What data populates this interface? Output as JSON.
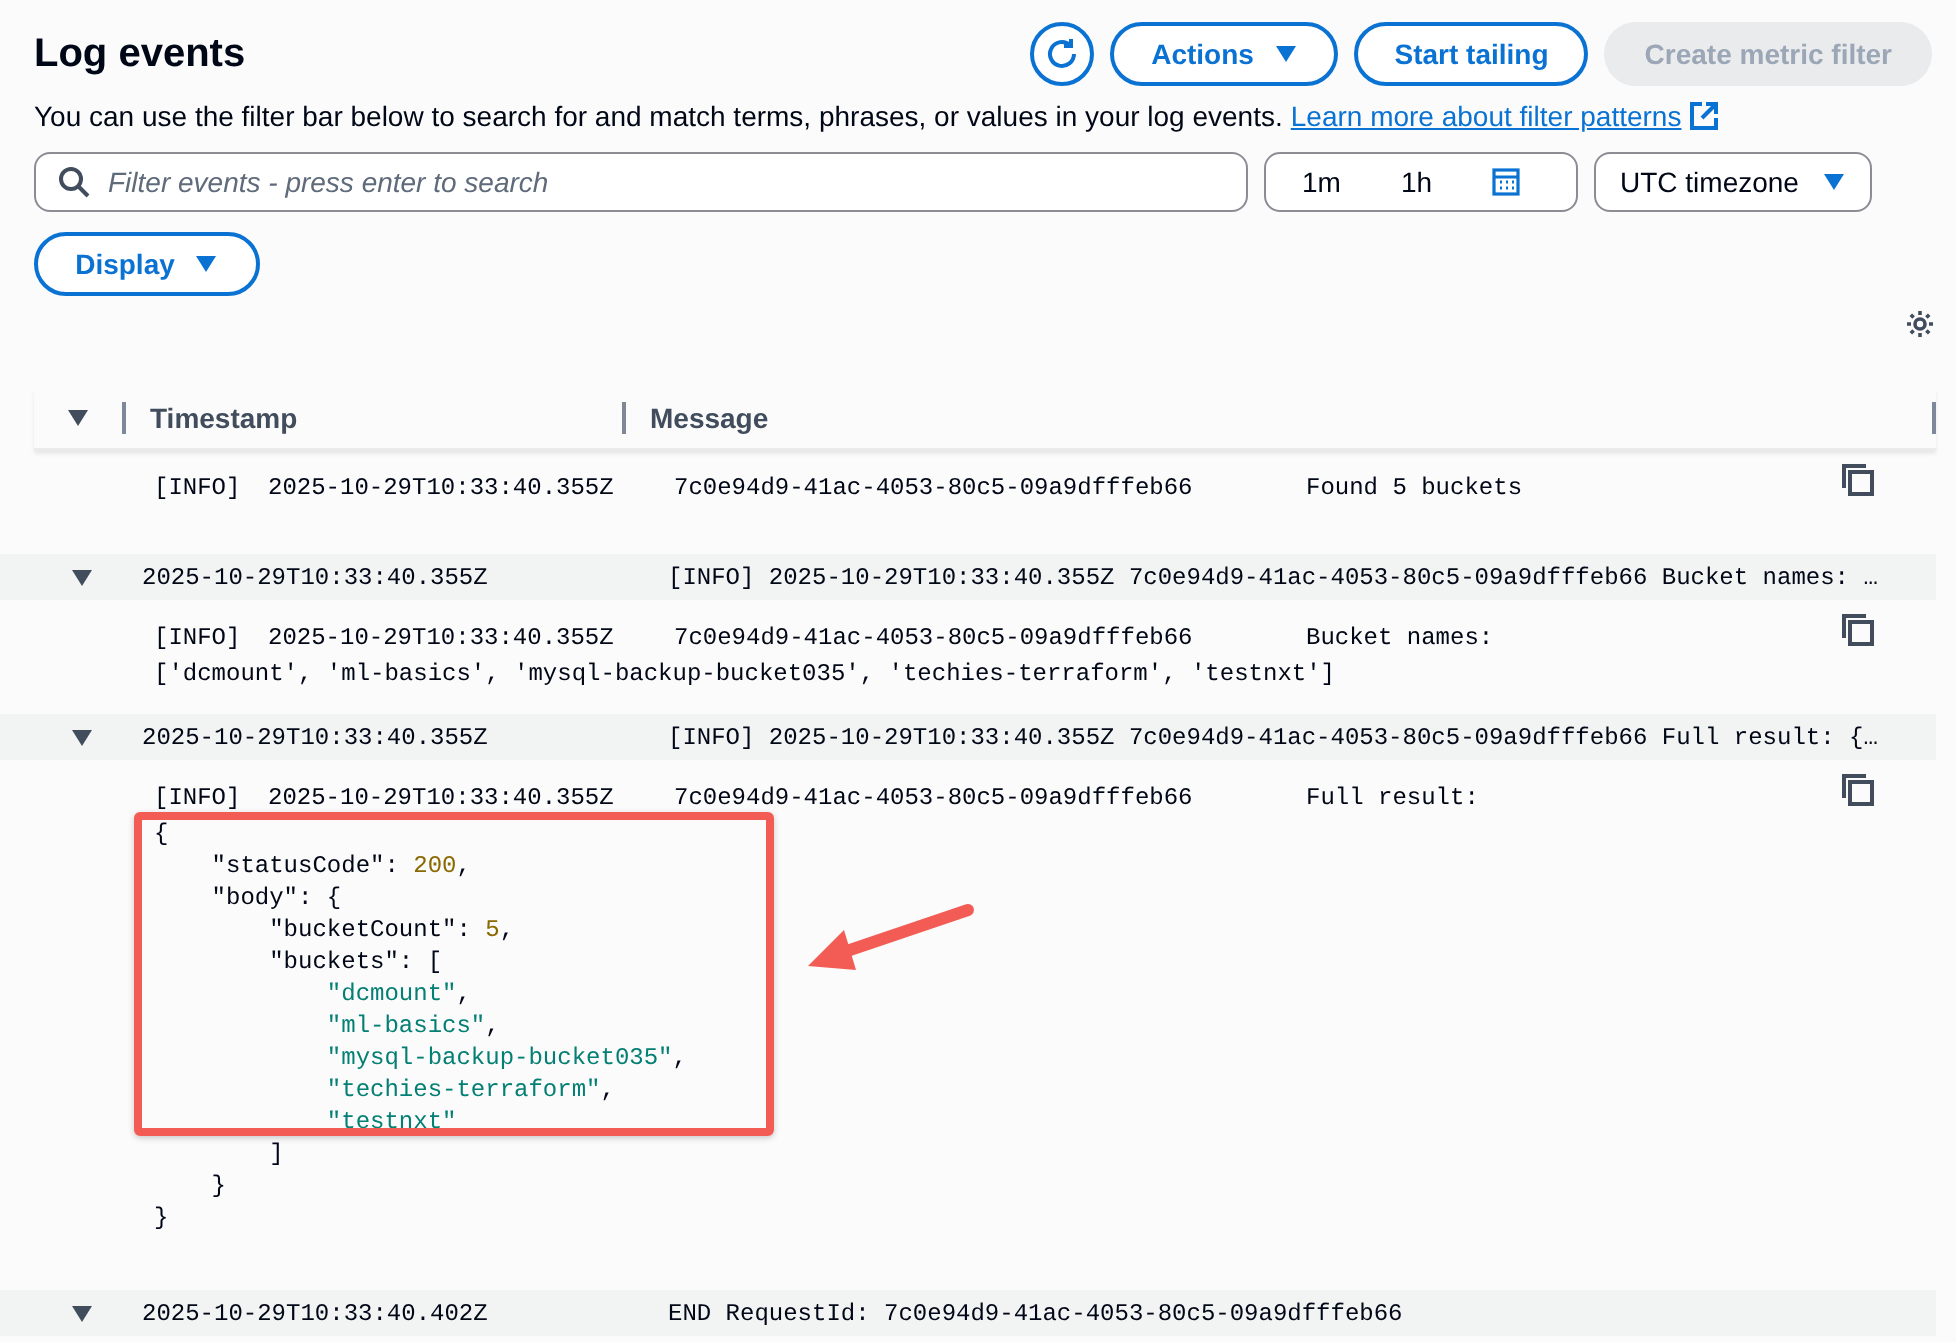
{
  "header": {
    "title": "Log events",
    "actions": "Actions",
    "start_tailing": "Start tailing",
    "create_metric_filter": "Create metric filter",
    "description": "You can use the filter bar below to search for and match terms, phrases, or values in your log events.",
    "learn_more": "Learn more about filter patterns"
  },
  "filter": {
    "placeholder": "Filter events - press enter to search",
    "ranges": [
      {
        "label": "1m",
        "selected": false
      },
      {
        "label": "1h",
        "selected": false
      }
    ],
    "timezone": "UTC timezone",
    "display": "Display"
  },
  "table": {
    "columns": [
      "Timestamp",
      "Message"
    ],
    "rows": [
      {
        "kind": "detail",
        "level": "[INFO]",
        "timestamp": "2025-10-29T10:33:40.355Z",
        "request_id": "7c0e94d9-41ac-4053-80c5-09a9dfffeb66",
        "message": "Found 5 buckets",
        "lines": []
      },
      {
        "kind": "summary",
        "expanded": true,
        "timestamp": "2025-10-29T10:33:40.355Z",
        "message": "[INFO] 2025-10-29T10:33:40.355Z 7c0e94d9-41ac-4053-80c5-09a9dfffeb66 Bucket names: …"
      },
      {
        "kind": "detail",
        "level": "[INFO]",
        "timestamp": "2025-10-29T10:33:40.355Z",
        "request_id": "7c0e94d9-41ac-4053-80c5-09a9dfffeb66",
        "message": "Bucket names:",
        "lines": [
          [
            {
              "kind": "plain",
              "text": "['dcmount', 'ml-basics', 'mysql-backup-bucket035', 'techies-terraform', 'testnxt']"
            }
          ]
        ]
      },
      {
        "kind": "summary",
        "expanded": true,
        "timestamp": "2025-10-29T10:33:40.355Z",
        "message": "[INFO] 2025-10-29T10:33:40.355Z 7c0e94d9-41ac-4053-80c5-09a9dfffeb66 Full result: {…"
      },
      {
        "kind": "detail",
        "level": "[INFO]",
        "timestamp": "2025-10-29T10:33:40.355Z",
        "request_id": "7c0e94d9-41ac-4053-80c5-09a9dfffeb66",
        "message": "Full result:",
        "lines": [
          [
            {
              "kind": "plain",
              "text": "{"
            }
          ],
          [
            {
              "kind": "plain",
              "text": "    \"statusCode\": "
            },
            {
              "kind": "number",
              "text": "200"
            },
            {
              "kind": "plain",
              "text": ","
            }
          ],
          [
            {
              "kind": "plain",
              "text": "    \"body\": {"
            }
          ],
          [
            {
              "kind": "plain",
              "text": "        \"bucketCount\": "
            },
            {
              "kind": "number",
              "text": "5"
            },
            {
              "kind": "plain",
              "text": ","
            }
          ],
          [
            {
              "kind": "plain",
              "text": "        \"buckets\": ["
            }
          ],
          [
            {
              "kind": "string",
              "text": "            \"dcmount\""
            },
            {
              "kind": "plain",
              "text": ","
            }
          ],
          [
            {
              "kind": "string",
              "text": "            \"ml-basics\""
            },
            {
              "kind": "plain",
              "text": ","
            }
          ],
          [
            {
              "kind": "string",
              "text": "            \"mysql-backup-bucket035\""
            },
            {
              "kind": "plain",
              "text": ","
            }
          ],
          [
            {
              "kind": "string",
              "text": "            \"techies-terraform\""
            },
            {
              "kind": "plain",
              "text": ","
            }
          ],
          [
            {
              "kind": "string",
              "text": "            \"testnxt\""
            }
          ],
          [
            {
              "kind": "plain",
              "text": "        ]"
            }
          ],
          [
            {
              "kind": "plain",
              "text": "    }"
            }
          ],
          [
            {
              "kind": "plain",
              "text": "}"
            }
          ]
        ]
      },
      {
        "kind": "summary",
        "expanded": true,
        "timestamp": "2025-10-29T10:33:40.402Z",
        "message": "END RequestId: 7c0e94d9-41ac-4053-80c5-09a9dfffeb66"
      }
    ]
  }
}
